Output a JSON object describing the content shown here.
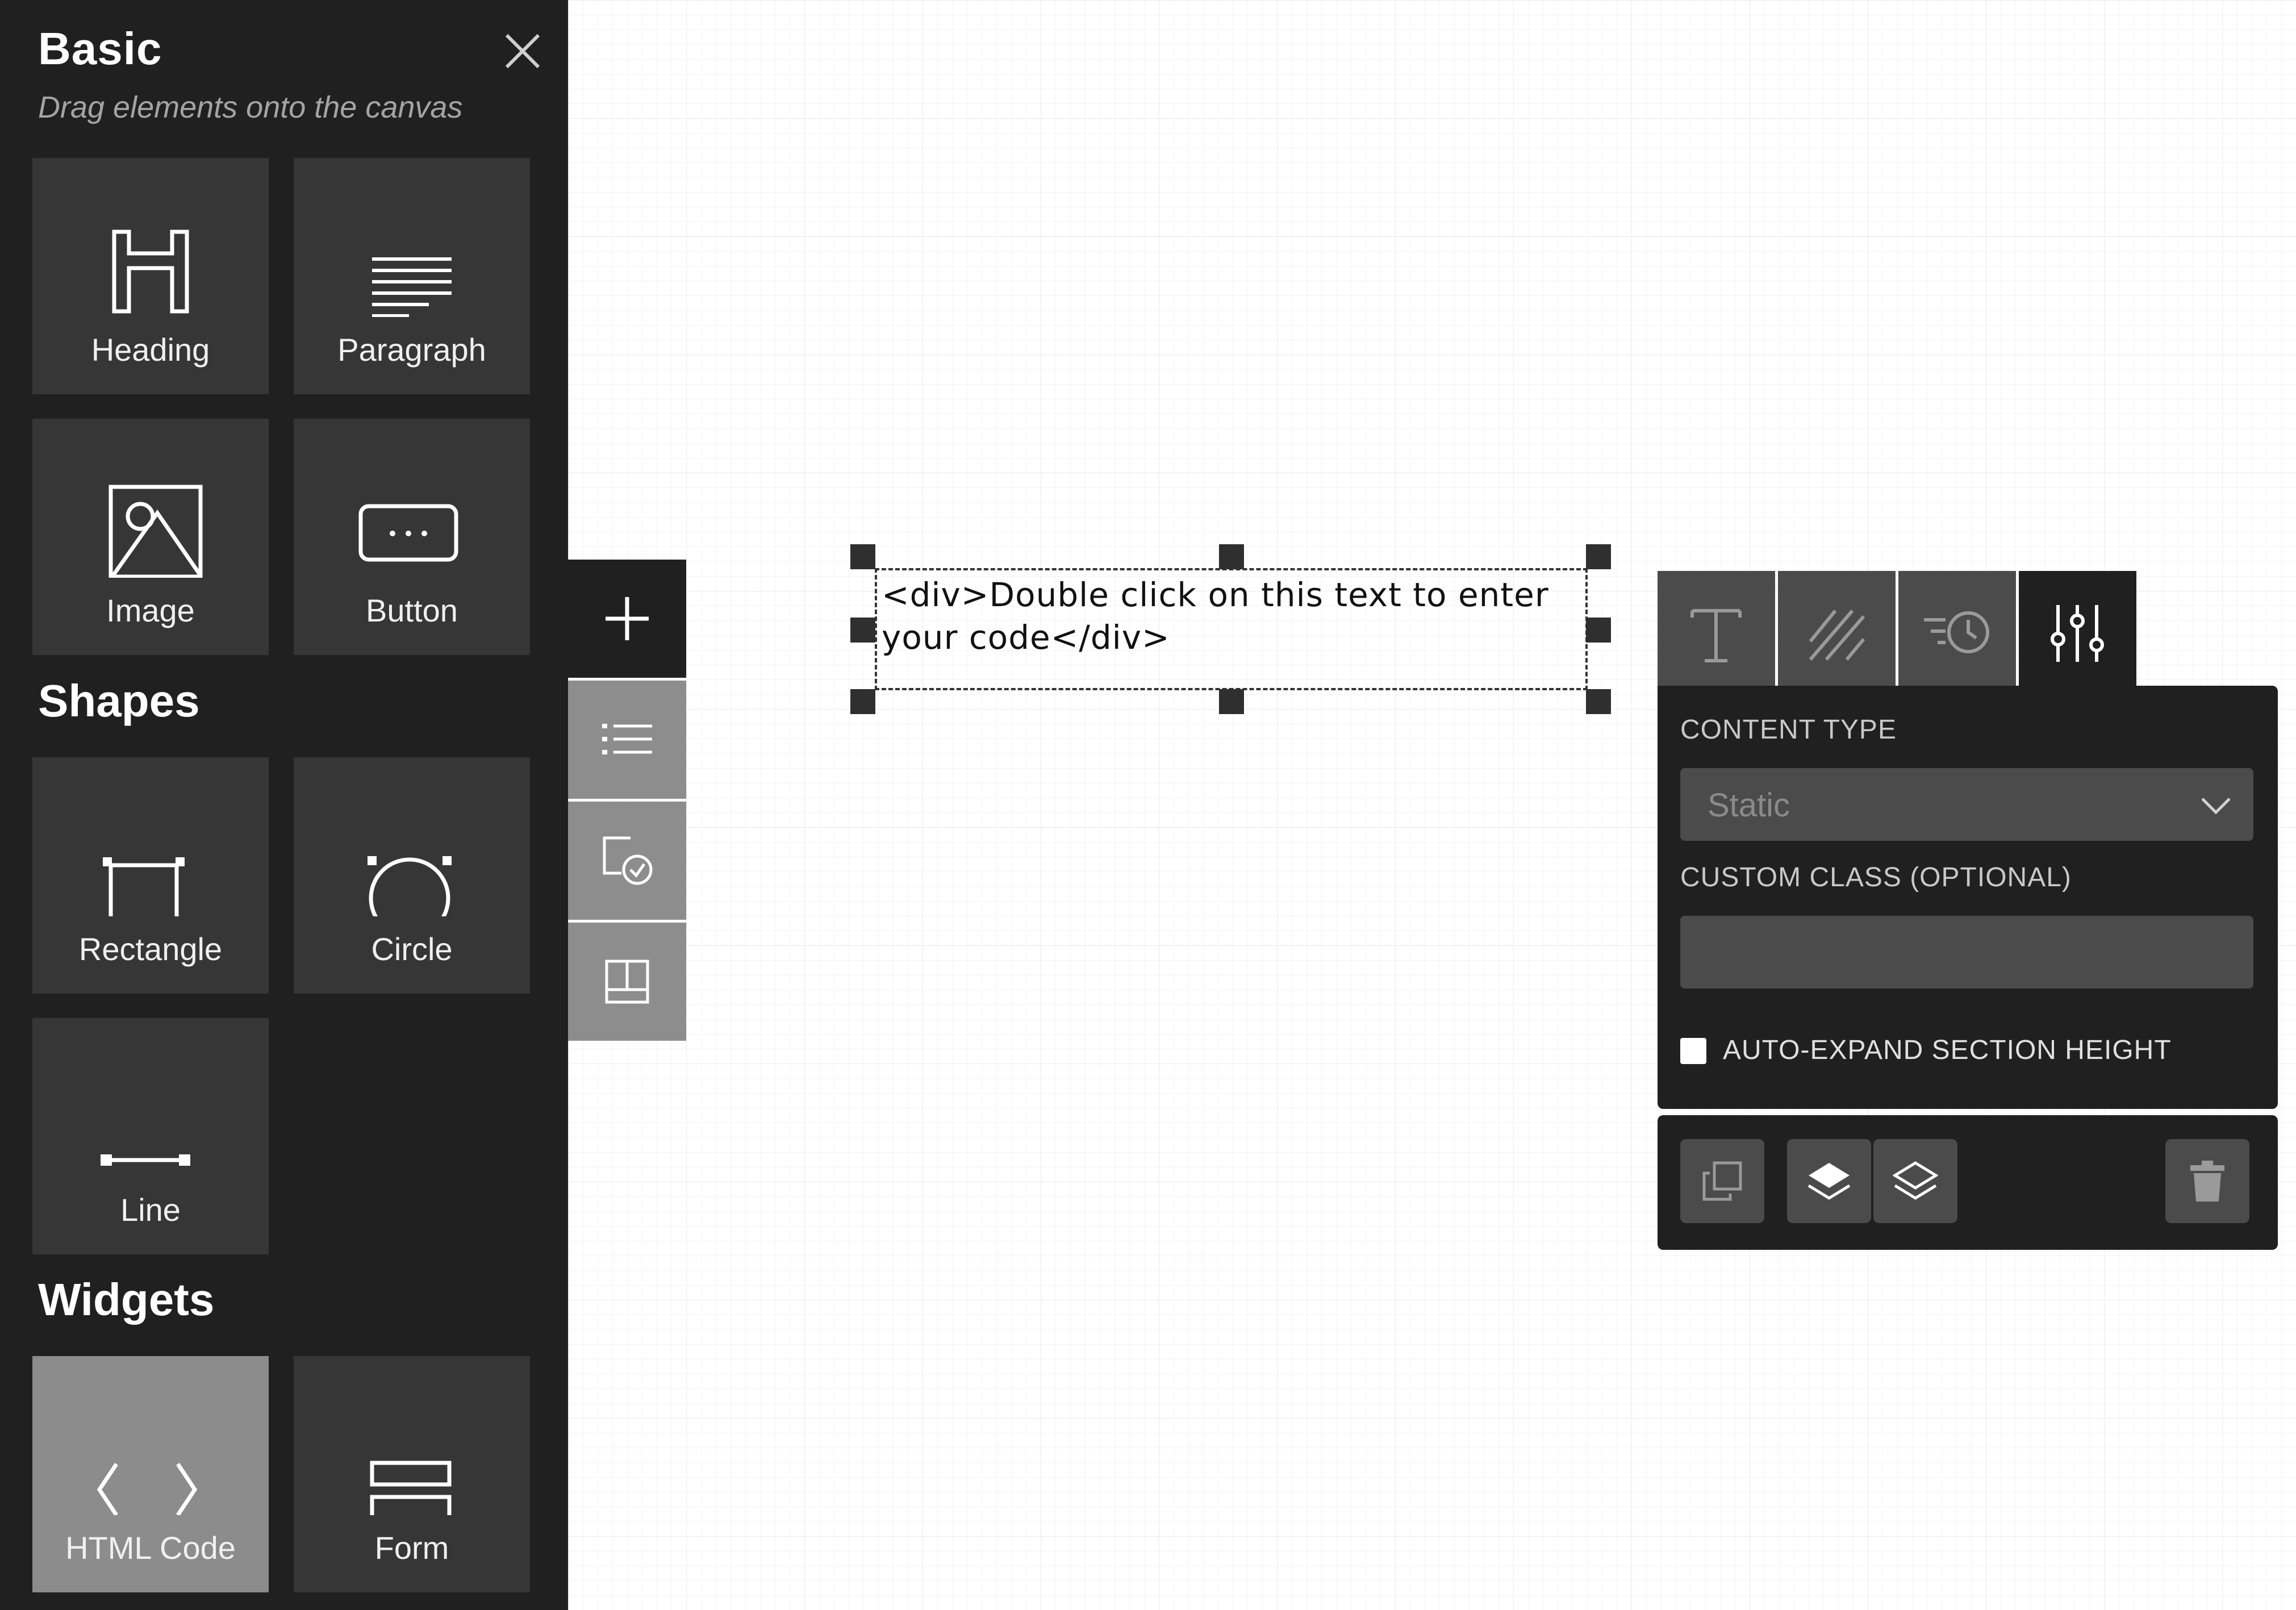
{
  "element_panel": {
    "title": "Basic",
    "subtitle": "Drag elements onto the canvas",
    "sections": {
      "shapes": "Shapes",
      "widgets": "Widgets"
    },
    "basic_items": [
      {
        "label": "Heading",
        "icon": "heading-icon"
      },
      {
        "label": "Paragraph",
        "icon": "paragraph-icon"
      },
      {
        "label": "Image",
        "icon": "image-icon"
      },
      {
        "label": "Button",
        "icon": "button-icon"
      }
    ],
    "shape_items": [
      {
        "label": "Rectangle",
        "icon": "rectangle-icon"
      },
      {
        "label": "Circle",
        "icon": "circle-icon"
      },
      {
        "label": "Line",
        "icon": "line-icon"
      }
    ],
    "widget_items": [
      {
        "label": "HTML Code",
        "icon": "code-icon",
        "active": true
      },
      {
        "label": "Form",
        "icon": "form-icon"
      }
    ]
  },
  "tool_strip": [
    "add-icon",
    "list-icon",
    "page-check-icon",
    "layout-icon"
  ],
  "canvas_element": {
    "text": "<div>Double click on this text to enter your code</div>"
  },
  "settings": {
    "tabs": [
      "text-icon",
      "style-icon",
      "animation-icon",
      "settings-sliders-icon"
    ],
    "active_tab": "settings-sliders-icon",
    "content_type_label": "CONTENT TYPE",
    "content_type_value": "Static",
    "custom_class_label": "CUSTOM CLASS (OPTIONAL)",
    "custom_class_value": "",
    "auto_expand_label": "AUTO-EXPAND SECTION HEIGHT",
    "auto_expand_checked": false
  },
  "actions": [
    "duplicate-icon",
    "bring-forward-icon",
    "send-backward-icon",
    "trash-icon"
  ],
  "colors": {
    "panel_bg": "#202020",
    "tile_bg": "#363636",
    "tile_active_bg": "#8c8c8c",
    "field_bg": "#4b4b4b"
  }
}
